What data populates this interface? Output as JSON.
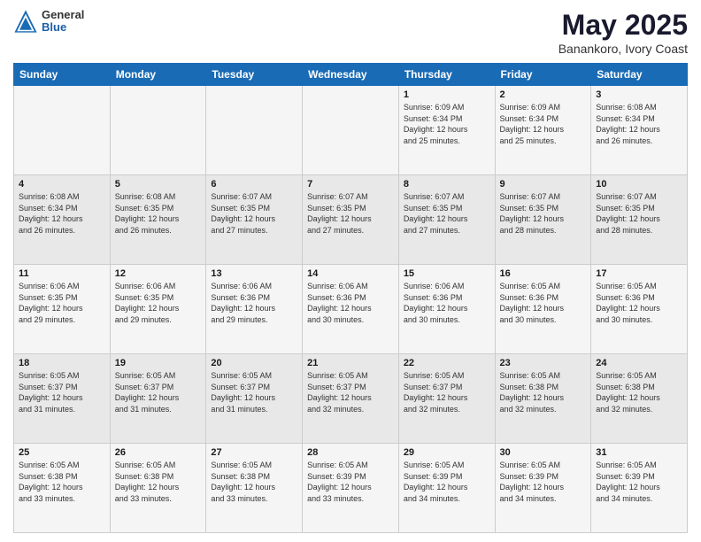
{
  "header": {
    "logo_general": "General",
    "logo_blue": "Blue",
    "main_title": "May 2025",
    "subtitle": "Banankoro, Ivory Coast"
  },
  "calendar": {
    "days_of_week": [
      "Sunday",
      "Monday",
      "Tuesday",
      "Wednesday",
      "Thursday",
      "Friday",
      "Saturday"
    ],
    "weeks": [
      [
        {
          "day": "",
          "info": ""
        },
        {
          "day": "",
          "info": ""
        },
        {
          "day": "",
          "info": ""
        },
        {
          "day": "",
          "info": ""
        },
        {
          "day": "1",
          "info": "Sunrise: 6:09 AM\nSunset: 6:34 PM\nDaylight: 12 hours\nand 25 minutes."
        },
        {
          "day": "2",
          "info": "Sunrise: 6:09 AM\nSunset: 6:34 PM\nDaylight: 12 hours\nand 25 minutes."
        },
        {
          "day": "3",
          "info": "Sunrise: 6:08 AM\nSunset: 6:34 PM\nDaylight: 12 hours\nand 26 minutes."
        }
      ],
      [
        {
          "day": "4",
          "info": "Sunrise: 6:08 AM\nSunset: 6:34 PM\nDaylight: 12 hours\nand 26 minutes."
        },
        {
          "day": "5",
          "info": "Sunrise: 6:08 AM\nSunset: 6:35 PM\nDaylight: 12 hours\nand 26 minutes."
        },
        {
          "day": "6",
          "info": "Sunrise: 6:07 AM\nSunset: 6:35 PM\nDaylight: 12 hours\nand 27 minutes."
        },
        {
          "day": "7",
          "info": "Sunrise: 6:07 AM\nSunset: 6:35 PM\nDaylight: 12 hours\nand 27 minutes."
        },
        {
          "day": "8",
          "info": "Sunrise: 6:07 AM\nSunset: 6:35 PM\nDaylight: 12 hours\nand 27 minutes."
        },
        {
          "day": "9",
          "info": "Sunrise: 6:07 AM\nSunset: 6:35 PM\nDaylight: 12 hours\nand 28 minutes."
        },
        {
          "day": "10",
          "info": "Sunrise: 6:07 AM\nSunset: 6:35 PM\nDaylight: 12 hours\nand 28 minutes."
        }
      ],
      [
        {
          "day": "11",
          "info": "Sunrise: 6:06 AM\nSunset: 6:35 PM\nDaylight: 12 hours\nand 29 minutes."
        },
        {
          "day": "12",
          "info": "Sunrise: 6:06 AM\nSunset: 6:35 PM\nDaylight: 12 hours\nand 29 minutes."
        },
        {
          "day": "13",
          "info": "Sunrise: 6:06 AM\nSunset: 6:36 PM\nDaylight: 12 hours\nand 29 minutes."
        },
        {
          "day": "14",
          "info": "Sunrise: 6:06 AM\nSunset: 6:36 PM\nDaylight: 12 hours\nand 30 minutes."
        },
        {
          "day": "15",
          "info": "Sunrise: 6:06 AM\nSunset: 6:36 PM\nDaylight: 12 hours\nand 30 minutes."
        },
        {
          "day": "16",
          "info": "Sunrise: 6:05 AM\nSunset: 6:36 PM\nDaylight: 12 hours\nand 30 minutes."
        },
        {
          "day": "17",
          "info": "Sunrise: 6:05 AM\nSunset: 6:36 PM\nDaylight: 12 hours\nand 30 minutes."
        }
      ],
      [
        {
          "day": "18",
          "info": "Sunrise: 6:05 AM\nSunset: 6:37 PM\nDaylight: 12 hours\nand 31 minutes."
        },
        {
          "day": "19",
          "info": "Sunrise: 6:05 AM\nSunset: 6:37 PM\nDaylight: 12 hours\nand 31 minutes."
        },
        {
          "day": "20",
          "info": "Sunrise: 6:05 AM\nSunset: 6:37 PM\nDaylight: 12 hours\nand 31 minutes."
        },
        {
          "day": "21",
          "info": "Sunrise: 6:05 AM\nSunset: 6:37 PM\nDaylight: 12 hours\nand 32 minutes."
        },
        {
          "day": "22",
          "info": "Sunrise: 6:05 AM\nSunset: 6:37 PM\nDaylight: 12 hours\nand 32 minutes."
        },
        {
          "day": "23",
          "info": "Sunrise: 6:05 AM\nSunset: 6:38 PM\nDaylight: 12 hours\nand 32 minutes."
        },
        {
          "day": "24",
          "info": "Sunrise: 6:05 AM\nSunset: 6:38 PM\nDaylight: 12 hours\nand 32 minutes."
        }
      ],
      [
        {
          "day": "25",
          "info": "Sunrise: 6:05 AM\nSunset: 6:38 PM\nDaylight: 12 hours\nand 33 minutes."
        },
        {
          "day": "26",
          "info": "Sunrise: 6:05 AM\nSunset: 6:38 PM\nDaylight: 12 hours\nand 33 minutes."
        },
        {
          "day": "27",
          "info": "Sunrise: 6:05 AM\nSunset: 6:38 PM\nDaylight: 12 hours\nand 33 minutes."
        },
        {
          "day": "28",
          "info": "Sunrise: 6:05 AM\nSunset: 6:39 PM\nDaylight: 12 hours\nand 33 minutes."
        },
        {
          "day": "29",
          "info": "Sunrise: 6:05 AM\nSunset: 6:39 PM\nDaylight: 12 hours\nand 34 minutes."
        },
        {
          "day": "30",
          "info": "Sunrise: 6:05 AM\nSunset: 6:39 PM\nDaylight: 12 hours\nand 34 minutes."
        },
        {
          "day": "31",
          "info": "Sunrise: 6:05 AM\nSunset: 6:39 PM\nDaylight: 12 hours\nand 34 minutes."
        }
      ]
    ]
  }
}
